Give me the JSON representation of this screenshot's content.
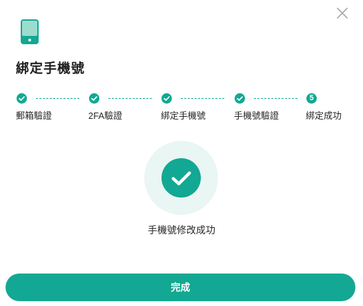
{
  "dialog": {
    "title": "綁定手機號",
    "header_icon": "smartphone-icon",
    "close_icon": "close-icon"
  },
  "steps": [
    {
      "label": "郵箱驗證",
      "status": "done",
      "icon": "check-icon"
    },
    {
      "label": "2FA驗證",
      "status": "done",
      "icon": "check-icon"
    },
    {
      "label": "綁定手機號",
      "status": "done",
      "icon": "check-icon"
    },
    {
      "label": "手機號驗證",
      "status": "done",
      "icon": "check-icon"
    },
    {
      "label": "綁定成功",
      "status": "current",
      "number": "5"
    }
  ],
  "result": {
    "icon": "success-check-icon",
    "message": "手機號修改成功"
  },
  "actions": {
    "done_label": "完成"
  },
  "colors": {
    "accent": "#12a893",
    "accent_light": "#e9f6f3",
    "icon_gray": "#a8a8a8"
  }
}
